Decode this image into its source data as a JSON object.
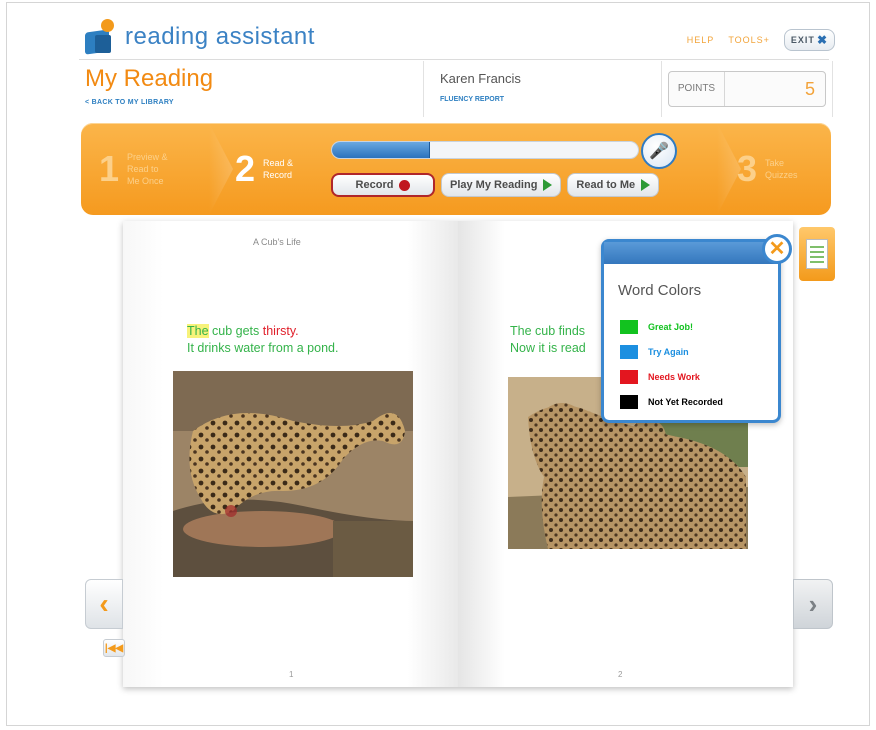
{
  "header": {
    "logo_text": "reading assistant",
    "help": "HELP",
    "tools": "TOOLS+",
    "exit": "EXIT"
  },
  "page": {
    "title": "My Reading",
    "back_link": "< BACK TO MY LIBRARY"
  },
  "student": {
    "name": "Karen Francis",
    "fluency_report": "FLUENCY REPORT"
  },
  "points": {
    "label": "POINTS",
    "value": "5"
  },
  "steps": {
    "step1": {
      "num": "1",
      "text1": "Preview &",
      "text2": "Read to",
      "text3": "Me Once"
    },
    "step2": {
      "num": "2",
      "text1": "Read &",
      "text2": "Record"
    },
    "step3": {
      "num": "3",
      "text1": "Take",
      "text2": "Quizzes"
    }
  },
  "progress": {
    "fraction": 0.32
  },
  "controls": {
    "record": "Record",
    "play_my_reading": "Play My Reading",
    "read_to_me": "Read to Me"
  },
  "book": {
    "title": "A Cub's Life",
    "left": {
      "word1": "The",
      "line1_mid": " cub gets ",
      "word_red": "thirsty.",
      "line2": "It drinks water from a pond.",
      "page_num": "1"
    },
    "right": {
      "line1": "The cub finds",
      "line2": "Now it is read",
      "page_num": "2"
    }
  },
  "word_colors": {
    "title": "Word Colors",
    "items": [
      {
        "label": "Great Job!",
        "color": "#12c21f"
      },
      {
        "label": "Try Again",
        "color": "#1c8fe0"
      },
      {
        "label": "Needs Work",
        "color": "#e3161f"
      },
      {
        "label": "Not Yet Recorded",
        "color": "#000000"
      }
    ]
  }
}
